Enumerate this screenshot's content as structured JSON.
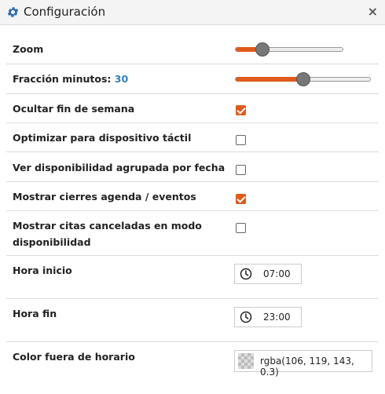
{
  "dialog": {
    "title": "Configuración",
    "close_label": "×"
  },
  "settings": {
    "zoom": {
      "label": "Zoom",
      "level": 0.25
    },
    "fraccion": {
      "label": "Fracción minutos: ",
      "value": "30",
      "level": 0.5
    },
    "ocultar_fin_semana": {
      "label": "Ocultar fin de semana",
      "checked": true
    },
    "optimizar_tactil": {
      "label": "Optimizar para dispositivo táctil",
      "checked": false
    },
    "ver_disponibilidad": {
      "label": "Ver disponibilidad agrupada por fecha",
      "checked": false
    },
    "mostrar_cierres": {
      "label": "Mostrar cierres agenda / eventos",
      "checked": true
    },
    "mostrar_canceladas": {
      "label_line1": "Mostrar citas canceladas en modo",
      "label_line2": "disponibilidad",
      "checked": false
    },
    "hora_inicio": {
      "label": "Hora inicio",
      "value": "07:00"
    },
    "hora_fin": {
      "label": "Hora fin",
      "value": "23:00"
    },
    "color_fuera": {
      "label": "Color fuera de horario",
      "value": "rgba(106, 119, 143, 0.3)"
    }
  },
  "icons": {
    "title": "gear-icon",
    "close": "close-icon",
    "time": "clock-icon"
  },
  "colors": {
    "accent": "#e05a1c",
    "value_blue": "#2f7fbf"
  }
}
